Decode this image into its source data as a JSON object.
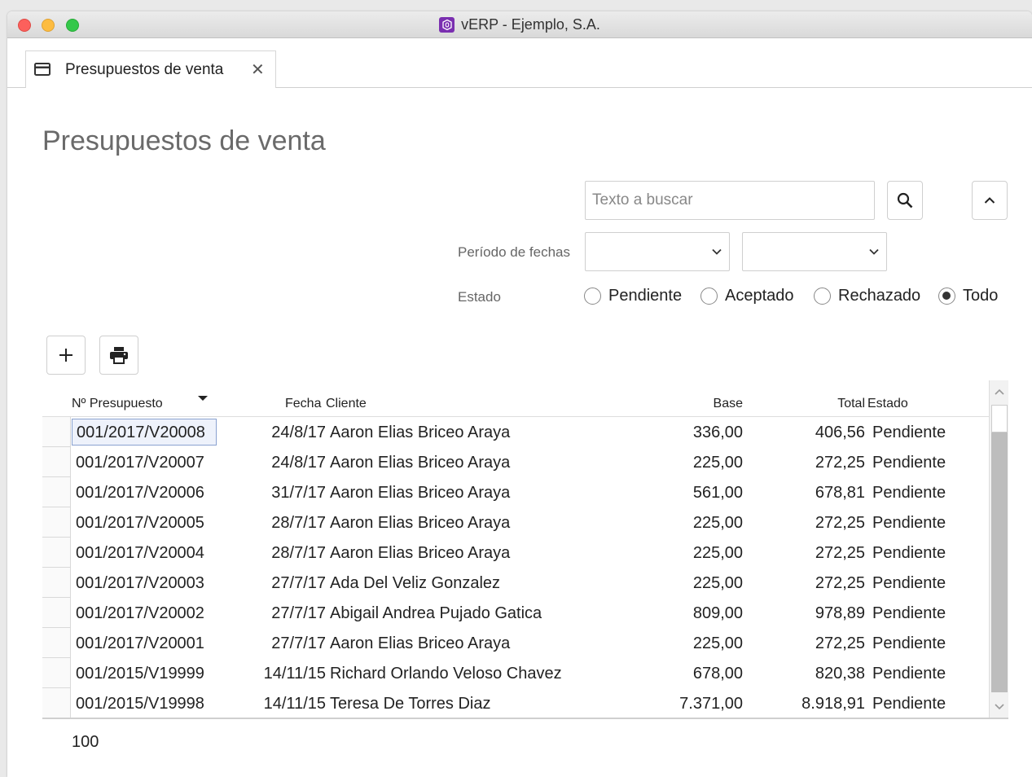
{
  "window": {
    "title": "vERP - Ejemplo, S.A."
  },
  "tab": {
    "label": "Presupuestos de venta",
    "close": "✕"
  },
  "page": {
    "title": "Presupuestos de venta"
  },
  "search": {
    "placeholder": "Texto a buscar",
    "value": ""
  },
  "filters": {
    "period_label": "Período de fechas",
    "estado_label": "Estado",
    "radios": [
      "Pendiente",
      "Aceptado",
      "Rechazado",
      "Todo"
    ],
    "selected": "Todo"
  },
  "table": {
    "headers": {
      "num": "Nº Presupuesto",
      "date": "Fecha",
      "client": "Cliente",
      "base": "Base",
      "total": "Total",
      "estado": "Estado"
    },
    "rows": [
      {
        "num": "001/2017/V20008",
        "date": "24/8/17",
        "client": "Aaron Elias Briceo Araya",
        "base": "336,00",
        "total": "406,56",
        "estado": "Pendiente"
      },
      {
        "num": "001/2017/V20007",
        "date": "24/8/17",
        "client": "Aaron Elias Briceo Araya",
        "base": "225,00",
        "total": "272,25",
        "estado": "Pendiente"
      },
      {
        "num": "001/2017/V20006",
        "date": "31/7/17",
        "client": "Aaron Elias Briceo Araya",
        "base": "561,00",
        "total": "678,81",
        "estado": "Pendiente"
      },
      {
        "num": "001/2017/V20005",
        "date": "28/7/17",
        "client": "Aaron Elias Briceo Araya",
        "base": "225,00",
        "total": "272,25",
        "estado": "Pendiente"
      },
      {
        "num": "001/2017/V20004",
        "date": "28/7/17",
        "client": "Aaron Elias Briceo Araya",
        "base": "225,00",
        "total": "272,25",
        "estado": "Pendiente"
      },
      {
        "num": "001/2017/V20003",
        "date": "27/7/17",
        "client": "Ada Del Veliz Gonzalez",
        "base": "225,00",
        "total": "272,25",
        "estado": "Pendiente"
      },
      {
        "num": "001/2017/V20002",
        "date": "27/7/17",
        "client": "Abigail Andrea Pujado Gatica",
        "base": "809,00",
        "total": "978,89",
        "estado": "Pendiente"
      },
      {
        "num": "001/2017/V20001",
        "date": "27/7/17",
        "client": "Aaron Elias Briceo Araya",
        "base": "225,00",
        "total": "272,25",
        "estado": "Pendiente"
      },
      {
        "num": "001/2015/V19999",
        "date": "14/11/15",
        "client": "Richard Orlando Veloso Chavez",
        "base": "678,00",
        "total": "820,38",
        "estado": "Pendiente"
      },
      {
        "num": "001/2015/V19998",
        "date": "14/11/15",
        "client": "Teresa De Torres Diaz",
        "base": "7.371,00",
        "total": "8.918,91",
        "estado": "Pendiente"
      }
    ],
    "count": "100"
  },
  "icons": {
    "app": "verp-logo-icon",
    "tab": "card-icon",
    "search": "search-icon",
    "collapse": "chevron-up-icon",
    "add": "plus-icon",
    "print": "printer-icon",
    "sort": "sort-desc-icon"
  },
  "colors": {
    "accent": "#7a2fb0",
    "selection_border": "#8aa2d0"
  }
}
